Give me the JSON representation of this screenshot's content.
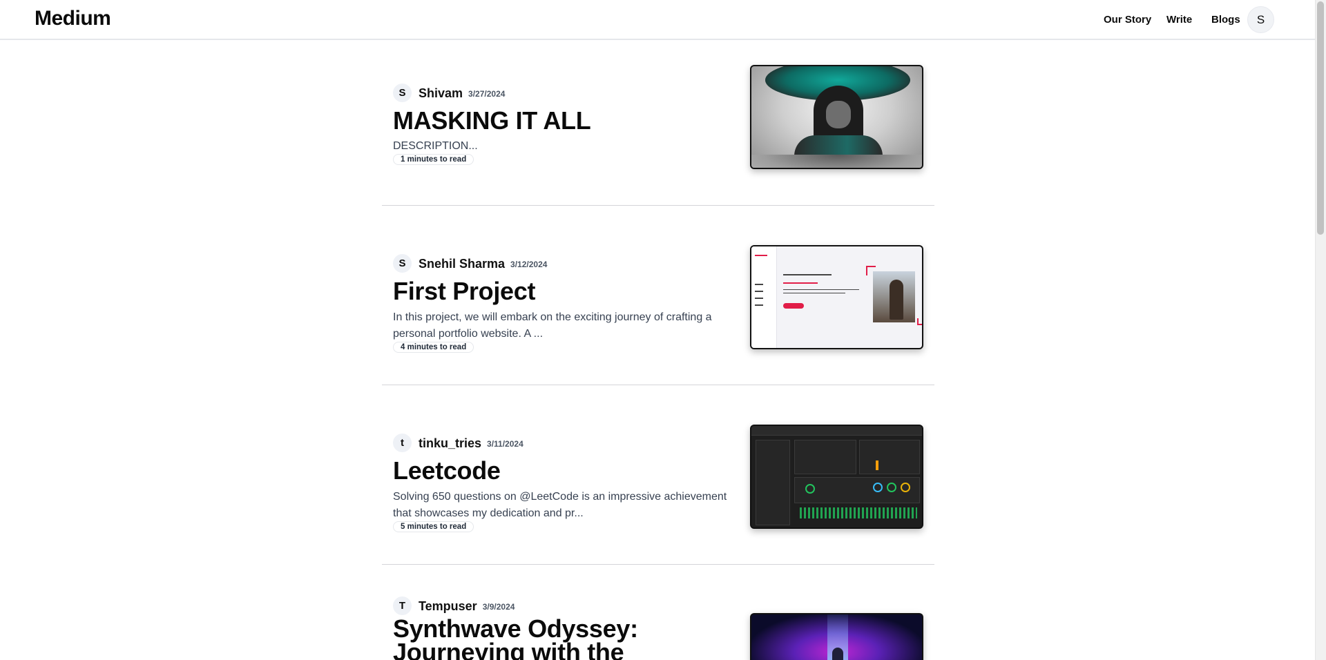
{
  "header": {
    "brand": "Medium",
    "nav": {
      "our_story": "Our Story",
      "write": "Write",
      "blogs": "Blogs"
    },
    "user_avatar_initial": "S"
  },
  "posts": [
    {
      "author_initial": "S",
      "author": "Shivam",
      "date": "3/27/2024",
      "title": "MASKING IT ALL",
      "description": "DESCRIPTION...",
      "read_time": "1 minutes to read"
    },
    {
      "author_initial": "S",
      "author": "Snehil Sharma",
      "date": "3/12/2024",
      "title": "First Project",
      "description": "In this project, we will embark on the exciting journey of crafting a personal portfolio website. A ...",
      "read_time": "4 minutes to read"
    },
    {
      "author_initial": "t",
      "author": "tinku_tries",
      "date": "3/11/2024",
      "title": "Leetcode",
      "description": "Solving 650 questions on @LeetCode is an impressive achievement that showcases my dedication and pr...",
      "read_time": "5 minutes to read"
    },
    {
      "author_initial": "T",
      "author": "Tempuser",
      "date": "3/9/2024",
      "title": "Synthwave Odyssey: Journeying with the Astronaut"
    }
  ]
}
